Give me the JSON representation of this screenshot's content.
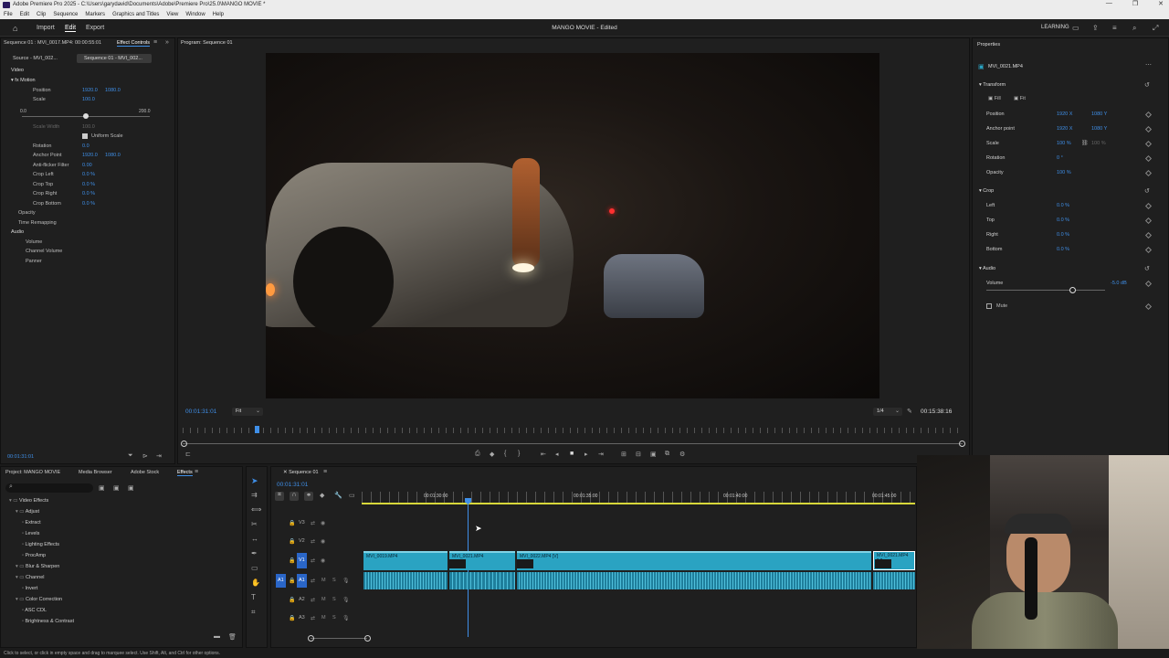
{
  "titlebar": {
    "title": "Adobe Premiere Pro 2025 - C:\\Users\\garydavid\\Documents\\Adobe\\Premiere Pro\\25.0\\MANGO MOVIE *"
  },
  "menu": [
    "File",
    "Edit",
    "Clip",
    "Sequence",
    "Markers",
    "Graphics and Titles",
    "View",
    "Window",
    "Help"
  ],
  "header": {
    "tabs": [
      "Import",
      "Edit",
      "Export"
    ],
    "active_tab": "Edit",
    "project_title": "MANGO MOVIE - Edited",
    "learning": "LEARNING"
  },
  "effect_controls": {
    "tab_source": "Sequence 01 : MVI_0017.MP4: 00:00:55:01",
    "tab_effect_controls": "Effect Controls",
    "source_tab": "Source - MVI_002...",
    "seq_tab": "Sequence 01 - MVI_002...",
    "video_label": "Video",
    "motion_label": "Motion",
    "position_label": "Position",
    "position_x": "1920.0",
    "position_y": "1080.0",
    "scale_label": "Scale",
    "scale_val": "100.0",
    "slider_min": "0.0",
    "slider_max": "200.0",
    "scale_width_label": "Scale Width",
    "scale_width_val": "100.0",
    "uniform_scale": "Uniform Scale",
    "rotation_label": "Rotation",
    "rotation_val": "0.0",
    "anchor_label": "Anchor Point",
    "anchor_x": "1920.0",
    "anchor_y": "1080.0",
    "antiflicker_label": "Anti-flicker Filter",
    "antiflicker_val": "0.00",
    "crop_left_label": "Crop Left",
    "crop_left_val": "0.0 %",
    "crop_top_label": "Crop Top",
    "crop_top_val": "0.0 %",
    "crop_right_label": "Crop Right",
    "crop_right_val": "0.0 %",
    "crop_bottom_label": "Crop Bottom",
    "crop_bottom_val": "0.0 %",
    "opacity_label": "Opacity",
    "time_remap_label": "Time Remapping",
    "audio_label": "Audio",
    "volume_label": "Volume",
    "channel_volume_label": "Channel Volume",
    "panner_label": "Panner",
    "timecode": "00:01:31:01"
  },
  "program": {
    "tab": "Program: Sequence 01",
    "timecode": "00:01:31:01",
    "fit": "Fit",
    "quality": "1/4",
    "duration": "00:15:38:16"
  },
  "properties": {
    "title": "Properties",
    "clip": "MVI_0021.MP4",
    "transform": "Transform",
    "fill": "Fill",
    "fit": "Fit",
    "position_label": "Position",
    "position_x": "1920 X",
    "position_y": "1080 Y",
    "anchor_label": "Anchor point",
    "anchor_x": "1920 X",
    "anchor_y": "1080 Y",
    "scale_label": "Scale",
    "scale_val": "100 %",
    "scale_val2": "100 %",
    "rotation_label": "Rotation",
    "rotation_val": "0 °",
    "opacity_label": "Opacity",
    "opacity_val": "100 %",
    "crop": "Crop",
    "left_label": "Left",
    "left_val": "0.0 %",
    "top_label": "Top",
    "top_val": "0.0 %",
    "right_label": "Right",
    "right_val": "0.0 %",
    "bottom_label": "Bottom",
    "bottom_val": "0.0 %",
    "audio": "Audio",
    "volume_label": "Volume",
    "volume_val": "-5.0 dB",
    "volume_level": 0.72,
    "mute_label": "Mute"
  },
  "project": {
    "tabs": [
      "Project: MANGO MOVIE",
      "Media Browser",
      "Adobe Stock",
      "Effects"
    ],
    "tree": [
      {
        "label": "Video Effects",
        "level": 1
      },
      {
        "label": "Adjust",
        "level": 2
      },
      {
        "label": "Extract",
        "level": 3
      },
      {
        "label": "Levels",
        "level": 3
      },
      {
        "label": "Lighting Effects",
        "level": 3
      },
      {
        "label": "ProcAmp",
        "level": 3
      },
      {
        "label": "Blur & Sharpen",
        "level": 2
      },
      {
        "label": "Channel",
        "level": 2
      },
      {
        "label": "Invert",
        "level": 3
      },
      {
        "label": "Color Correction",
        "level": 2
      },
      {
        "label": "ASC CDL",
        "level": 3
      },
      {
        "label": "Brightness & Contrast",
        "level": 3
      }
    ]
  },
  "timeline": {
    "tab": "Sequence 01",
    "timecode": "00:01:31:01",
    "ruler": [
      "00:01:30:00",
      "00:01:35:00",
      "00:01:40:00",
      "00:01:45:00"
    ],
    "video_tracks": [
      "V3",
      "V2",
      "V1"
    ],
    "audio_tracks": [
      "A1",
      "A2",
      "A3"
    ],
    "clips": [
      "MVI_0019.MP4",
      "MVI_0021.MP4",
      "MVI_0022.MP4 [V]",
      "MVI_0021.MP4 [V]"
    ],
    "letters": {
      "m": "M",
      "s": "S"
    }
  },
  "status": {
    "text": "Click to select, or click in empty space and drag to marquee select. Use Shift, Alt, and Ctrl for other options."
  }
}
